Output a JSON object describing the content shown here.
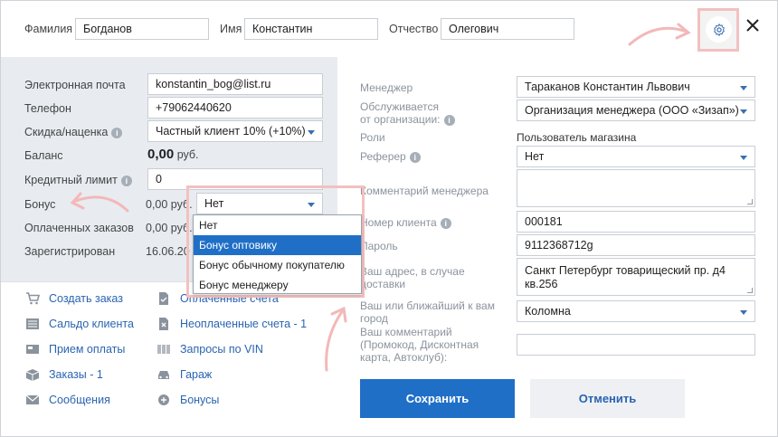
{
  "header": {
    "surname_label": "Фамилия",
    "surname_value": "Богданов",
    "name_label": "Имя",
    "name_value": "Константин",
    "patronymic_label": "Отчество",
    "patronymic_value": "Олегович"
  },
  "left": {
    "email_label": "Электронная почта",
    "email_value": "konstantin_bog@list.ru",
    "phone_label": "Телефон",
    "phone_value": "+79062440620",
    "discount_label": "Скидка/наценка",
    "discount_value": "Частный клиент 10% (+10%)",
    "balance_label": "Баланс",
    "balance_value": "0,00",
    "balance_unit": "руб.",
    "credit_label": "Кредитный лимит",
    "credit_value": "0",
    "bonus_label": "Бонус",
    "bonus_amount": "0,00 руб.",
    "bonus_select": "Нет",
    "paid_label": "Оплаченных заказов",
    "paid_value": "0,00 руб.",
    "registered_label": "Зарегистрирован",
    "registered_value": "16.06.20"
  },
  "bonus_dropdown": {
    "options": [
      "Нет",
      "Бонус оптовику",
      "Бонус обычному покупателю",
      "Бонус менеджеру"
    ],
    "highlighted": "Бонус оптовику"
  },
  "links": {
    "create_order": "Создать заказ",
    "client_balance": "Сальдо клиента",
    "receive_payment": "Прием оплаты",
    "orders": "Заказы - 1",
    "messages": "Сообщения",
    "paid_invoices": "Оплаченные счета",
    "unpaid_invoices": "Неоплаченные счета - 1",
    "vin_requests": "Запросы по VIN",
    "garage": "Гараж",
    "bonuses": "Бонусы"
  },
  "right": {
    "manager_label": "Менеджер",
    "manager_value": "Тараканов Константин Львович",
    "org_label_1": "Обслуживается",
    "org_label_2": "от организации:",
    "org_value": "Организация менеджера (ООО «Зизап»)",
    "roles_label": "Роли",
    "roles_value": "Пользователь магазина",
    "referrer_label": "Реферер",
    "referrer_value": "Нет",
    "manager_comment_label": "Комментарий менеджера",
    "client_number_label": "Номер клиента",
    "client_number_value": "000181",
    "password_label": "Пароль",
    "password_value": "9112368712g",
    "address_label_1": "Ваш адрес, в случае",
    "address_label_2": "доставки",
    "address_value": "Санкт Петербург товарищеский пр. д4 кв.256",
    "city_label_1": "Ваш или ближайший к вам",
    "city_label_2": "город",
    "city_value": "Коломна",
    "comment_label_1": "Ваш комментарий",
    "comment_label_2": "(Промокод, Дисконтная",
    "comment_label_3": "карта, Автоклуб):"
  },
  "buttons": {
    "save": "Сохранить",
    "cancel": "Отменить"
  },
  "colors": {
    "accent": "#1f6fc7",
    "link": "#2a64b0",
    "panel": "#e8ecf1",
    "annotation": "#f3c0c0"
  }
}
